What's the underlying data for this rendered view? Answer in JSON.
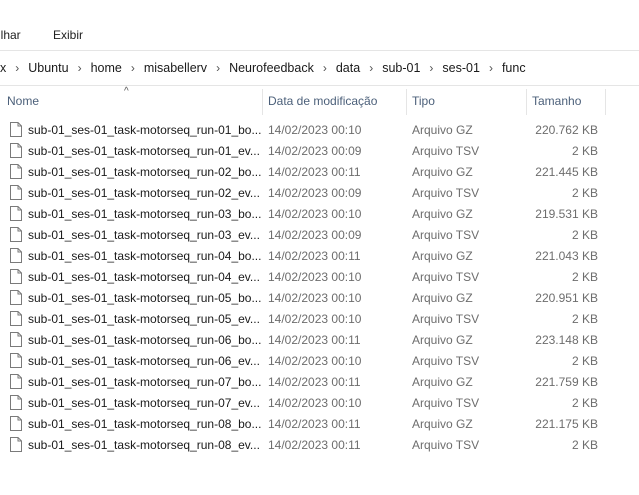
{
  "menubar": {
    "items": [
      "ilhar",
      "Exibir"
    ]
  },
  "address": {
    "crumbs": [
      "x",
      "Ubuntu",
      "home",
      "misabellerv",
      "Neurofeedback",
      "data",
      "sub-01",
      "ses-01",
      "func"
    ],
    "separator": "›"
  },
  "columns": {
    "name": "Nome",
    "date": "Data de modificação",
    "type": "Tipo",
    "size": "Tamanho",
    "sort_indicator": "^"
  },
  "files": [
    {
      "name": "sub-01_ses-01_task-motorseq_run-01_bo...",
      "date": "14/02/2023 00:10",
      "type": "Arquivo GZ",
      "size": "220.762 KB"
    },
    {
      "name": "sub-01_ses-01_task-motorseq_run-01_ev...",
      "date": "14/02/2023 00:09",
      "type": "Arquivo TSV",
      "size": "2 KB"
    },
    {
      "name": "sub-01_ses-01_task-motorseq_run-02_bo...",
      "date": "14/02/2023 00:11",
      "type": "Arquivo GZ",
      "size": "221.445 KB"
    },
    {
      "name": "sub-01_ses-01_task-motorseq_run-02_ev...",
      "date": "14/02/2023 00:09",
      "type": "Arquivo TSV",
      "size": "2 KB"
    },
    {
      "name": "sub-01_ses-01_task-motorseq_run-03_bo...",
      "date": "14/02/2023 00:10",
      "type": "Arquivo GZ",
      "size": "219.531 KB"
    },
    {
      "name": "sub-01_ses-01_task-motorseq_run-03_ev...",
      "date": "14/02/2023 00:09",
      "type": "Arquivo TSV",
      "size": "2 KB"
    },
    {
      "name": "sub-01_ses-01_task-motorseq_run-04_bo...",
      "date": "14/02/2023 00:11",
      "type": "Arquivo GZ",
      "size": "221.043 KB"
    },
    {
      "name": "sub-01_ses-01_task-motorseq_run-04_ev...",
      "date": "14/02/2023 00:10",
      "type": "Arquivo TSV",
      "size": "2 KB"
    },
    {
      "name": "sub-01_ses-01_task-motorseq_run-05_bo...",
      "date": "14/02/2023 00:10",
      "type": "Arquivo GZ",
      "size": "220.951 KB"
    },
    {
      "name": "sub-01_ses-01_task-motorseq_run-05_ev...",
      "date": "14/02/2023 00:10",
      "type": "Arquivo TSV",
      "size": "2 KB"
    },
    {
      "name": "sub-01_ses-01_task-motorseq_run-06_bo...",
      "date": "14/02/2023 00:11",
      "type": "Arquivo GZ",
      "size": "223.148 KB"
    },
    {
      "name": "sub-01_ses-01_task-motorseq_run-06_ev...",
      "date": "14/02/2023 00:10",
      "type": "Arquivo TSV",
      "size": "2 KB"
    },
    {
      "name": "sub-01_ses-01_task-motorseq_run-07_bo...",
      "date": "14/02/2023 00:11",
      "type": "Arquivo GZ",
      "size": "221.759 KB"
    },
    {
      "name": "sub-01_ses-01_task-motorseq_run-07_ev...",
      "date": "14/02/2023 00:10",
      "type": "Arquivo TSV",
      "size": "2 KB"
    },
    {
      "name": "sub-01_ses-01_task-motorseq_run-08_bo...",
      "date": "14/02/2023 00:11",
      "type": "Arquivo GZ",
      "size": "221.175 KB"
    },
    {
      "name": "sub-01_ses-01_task-motorseq_run-08_ev...",
      "date": "14/02/2023 00:11",
      "type": "Arquivo TSV",
      "size": "2 KB"
    }
  ],
  "icons": {
    "file": "file-icon",
    "sort": "sort-ascending-icon"
  },
  "colors": {
    "header_text": "#4c607a",
    "secondary_text": "#6d6d6d",
    "divider": "#e5e5e5"
  }
}
